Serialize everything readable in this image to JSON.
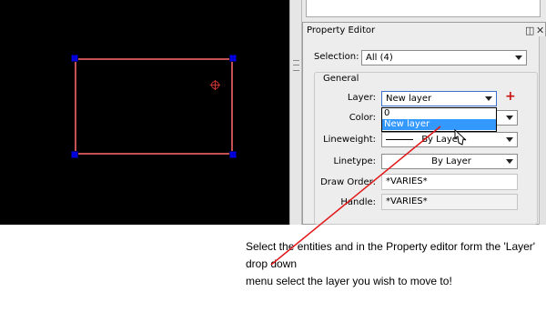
{
  "panel": {
    "title": "Property Editor",
    "selection_label": "Selection:",
    "selection_value": "All (4)",
    "group_title": "General",
    "rows": {
      "layer_label": "Layer:",
      "layer_value": "New layer",
      "color_label": "Color:",
      "lineweight_label": "Lineweight:",
      "lineweight_value": "By Layer",
      "linetype_label": "Linetype:",
      "linetype_value": "By Layer",
      "draw_order_label": "Draw Order:",
      "draw_order_value": "*VARIES*",
      "handle_label": "Handle:",
      "handle_value": "*VARIES*"
    },
    "dropdown_options": [
      "0",
      "New layer"
    ],
    "add_icon": "plus-icon",
    "controls": {
      "float_icon": "float-icon",
      "close_icon": "close-icon"
    }
  },
  "caption": {
    "line1": "Select the entities and in the Property editor form the 'Layer' drop down",
    "line2": "menu select the layer you wish to move to!"
  },
  "colors": {
    "canvas": "#000000",
    "entity_outline": "#c35151",
    "grip": "#0000d8",
    "highlight": "#3399ff",
    "annotation_arrow": "#e01818"
  }
}
